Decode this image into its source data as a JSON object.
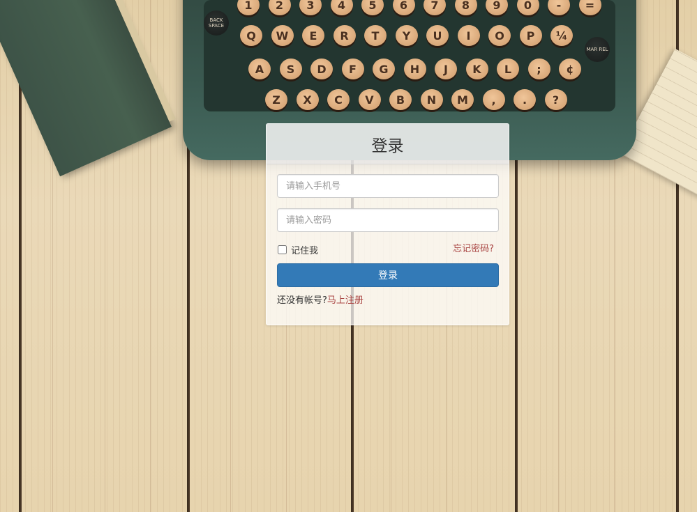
{
  "login": {
    "title": "登录",
    "phone_placeholder": "请输入手机号",
    "password_placeholder": "请输入密码",
    "remember_label": "记住我",
    "forgot_label": "忘记密码?",
    "submit_label": "登录",
    "no_account_text": "还没有帐号?",
    "register_label": "马上注册"
  },
  "colors": {
    "primary_button": "#337ab7",
    "link_red": "#a94442",
    "panel_bg": "rgba(255,255,255,0.72)"
  },
  "background": {
    "keys_row_top": [
      "1",
      "2",
      "3",
      "4",
      "5",
      "6",
      "7",
      "8",
      "9",
      "0",
      "-",
      "="
    ],
    "keys_row_1": [
      "Q",
      "W",
      "E",
      "R",
      "T",
      "Y",
      "U",
      "I",
      "O",
      "P",
      "¼"
    ],
    "keys_row_2": [
      "A",
      "S",
      "D",
      "F",
      "G",
      "H",
      "J",
      "K",
      "L",
      ";",
      "¢"
    ],
    "keys_row_3": [
      "Z",
      "X",
      "C",
      "V",
      "B",
      "N",
      "M",
      ",",
      ".",
      "?"
    ],
    "back_space_label": "BACK SPACE",
    "mar_rel_label": "MAR REL"
  }
}
